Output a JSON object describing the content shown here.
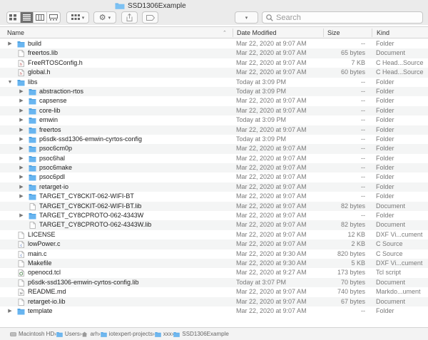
{
  "window": {
    "title": "SSD1306Example"
  },
  "toolbar": {
    "search_placeholder": "Search",
    "view_modes": [
      "icon-view",
      "list-view",
      "column-view",
      "gallery-view"
    ],
    "active_view": "list-view"
  },
  "columns": {
    "name": "Name",
    "date": "Date Modified",
    "size": "Size",
    "kind": "Kind"
  },
  "rows": [
    {
      "name": "build",
      "date": "Mar 22, 2020 at 9:07 AM",
      "size": "--",
      "kind": "Folder",
      "type": "folder",
      "level": 0,
      "disclosure": "collapsed"
    },
    {
      "name": "freertos.lib",
      "date": "Mar 22, 2020 at 9:07 AM",
      "size": "65 bytes",
      "kind": "Document",
      "type": "file",
      "level": 0,
      "disclosure": "none"
    },
    {
      "name": "FreeRTOSConfig.h",
      "date": "Mar 22, 2020 at 9:07 AM",
      "size": "7 KB",
      "kind": "C Head...Source",
      "type": "header",
      "level": 0,
      "disclosure": "none"
    },
    {
      "name": "global.h",
      "date": "Mar 22, 2020 at 9:07 AM",
      "size": "60 bytes",
      "kind": "C Head...Source",
      "type": "header",
      "level": 0,
      "disclosure": "none"
    },
    {
      "name": "libs",
      "date": "Today at 3:09 PM",
      "size": "--",
      "kind": "Folder",
      "type": "folder",
      "level": 0,
      "disclosure": "expanded"
    },
    {
      "name": "abstraction-rtos",
      "date": "Today at 3:09 PM",
      "size": "--",
      "kind": "Folder",
      "type": "folder",
      "level": 1,
      "disclosure": "collapsed"
    },
    {
      "name": "capsense",
      "date": "Mar 22, 2020 at 9:07 AM",
      "size": "--",
      "kind": "Folder",
      "type": "folder",
      "level": 1,
      "disclosure": "collapsed"
    },
    {
      "name": "core-lib",
      "date": "Mar 22, 2020 at 9:07 AM",
      "size": "--",
      "kind": "Folder",
      "type": "folder",
      "level": 1,
      "disclosure": "collapsed"
    },
    {
      "name": "emwin",
      "date": "Today at 3:09 PM",
      "size": "--",
      "kind": "Folder",
      "type": "folder",
      "level": 1,
      "disclosure": "collapsed"
    },
    {
      "name": "freertos",
      "date": "Mar 22, 2020 at 9:07 AM",
      "size": "--",
      "kind": "Folder",
      "type": "folder",
      "level": 1,
      "disclosure": "collapsed"
    },
    {
      "name": "p6sdk-ssd1306-emwin-cyrtos-config",
      "date": "Today at 3:09 PM",
      "size": "--",
      "kind": "Folder",
      "type": "folder",
      "level": 1,
      "disclosure": "collapsed"
    },
    {
      "name": "psoc6cm0p",
      "date": "Mar 22, 2020 at 9:07 AM",
      "size": "--",
      "kind": "Folder",
      "type": "folder",
      "level": 1,
      "disclosure": "collapsed"
    },
    {
      "name": "psoc6hal",
      "date": "Mar 22, 2020 at 9:07 AM",
      "size": "--",
      "kind": "Folder",
      "type": "folder",
      "level": 1,
      "disclosure": "collapsed"
    },
    {
      "name": "psoc6make",
      "date": "Mar 22, 2020 at 9:07 AM",
      "size": "--",
      "kind": "Folder",
      "type": "folder",
      "level": 1,
      "disclosure": "collapsed"
    },
    {
      "name": "psoc6pdl",
      "date": "Mar 22, 2020 at 9:07 AM",
      "size": "--",
      "kind": "Folder",
      "type": "folder",
      "level": 1,
      "disclosure": "collapsed"
    },
    {
      "name": "retarget-io",
      "date": "Mar 22, 2020 at 9:07 AM",
      "size": "--",
      "kind": "Folder",
      "type": "folder",
      "level": 1,
      "disclosure": "collapsed"
    },
    {
      "name": "TARGET_CY8CKIT-062-WIFI-BT",
      "date": "Mar 22, 2020 at 9:07 AM",
      "size": "--",
      "kind": "Folder",
      "type": "folder",
      "level": 1,
      "disclosure": "collapsed"
    },
    {
      "name": "TARGET_CY8CKIT-062-WIFI-BT.lib",
      "date": "Mar 22, 2020 at 9:07 AM",
      "size": "82 bytes",
      "kind": "Document",
      "type": "file",
      "level": 1,
      "disclosure": "none"
    },
    {
      "name": "TARGET_CY8CPROTO-062-4343W",
      "date": "Mar 22, 2020 at 9:07 AM",
      "size": "--",
      "kind": "Folder",
      "type": "folder",
      "level": 1,
      "disclosure": "collapsed"
    },
    {
      "name": "TARGET_CY8CPROTO-062-4343W.lib",
      "date": "Mar 22, 2020 at 9:07 AM",
      "size": "82 bytes",
      "kind": "Document",
      "type": "file",
      "level": 1,
      "disclosure": "none"
    },
    {
      "name": "LICENSE",
      "date": "Mar 22, 2020 at 9:07 AM",
      "size": "12 KB",
      "kind": "DXF Vi...cument",
      "type": "file",
      "level": 0,
      "disclosure": "none"
    },
    {
      "name": "lowPower.c",
      "date": "Mar 22, 2020 at 9:07 AM",
      "size": "2 KB",
      "kind": "C Source",
      "type": "csource",
      "level": 0,
      "disclosure": "none"
    },
    {
      "name": "main.c",
      "date": "Mar 22, 2020 at 9:30 AM",
      "size": "820 bytes",
      "kind": "C Source",
      "type": "csource",
      "level": 0,
      "disclosure": "none"
    },
    {
      "name": "Makefile",
      "date": "Mar 22, 2020 at 9:30 AM",
      "size": "5 KB",
      "kind": "DXF Vi...cument",
      "type": "file",
      "level": 0,
      "disclosure": "none"
    },
    {
      "name": "openocd.tcl",
      "date": "Mar 22, 2020 at 9:27 AM",
      "size": "173 bytes",
      "kind": "Tcl script",
      "type": "script",
      "level": 0,
      "disclosure": "none"
    },
    {
      "name": "p6sdk-ssd1306-emwin-cyrtos-config.lib",
      "date": "Today at 3:07 PM",
      "size": "70 bytes",
      "kind": "Document",
      "type": "file",
      "level": 0,
      "disclosure": "none"
    },
    {
      "name": "README.md",
      "date": "Mar 22, 2020 at 9:07 AM",
      "size": "740 bytes",
      "kind": "Markdo...ument",
      "type": "markdown",
      "level": 0,
      "disclosure": "none"
    },
    {
      "name": "retarget-io.lib",
      "date": "Mar 22, 2020 at 9:07 AM",
      "size": "67 bytes",
      "kind": "Document",
      "type": "file",
      "level": 0,
      "disclosure": "none"
    },
    {
      "name": "template",
      "date": "Mar 22, 2020 at 9:07 AM",
      "size": "--",
      "kind": "Folder",
      "type": "folder",
      "level": 0,
      "disclosure": "collapsed"
    }
  ],
  "pathbar": [
    {
      "label": "Macintosh HD",
      "icon": "hard-drive-icon"
    },
    {
      "label": "Users",
      "icon": "folder-icon"
    },
    {
      "label": "arh",
      "icon": "home-icon"
    },
    {
      "label": "iotexpert-projects",
      "icon": "folder-icon"
    },
    {
      "label": "xxx",
      "icon": "folder-icon"
    },
    {
      "label": "SSD1306Example",
      "icon": "folder-icon"
    }
  ],
  "colors": {
    "folder": "#68b5f0",
    "folder_dark": "#4a9fe0",
    "header_icon": "#b84a4a"
  }
}
